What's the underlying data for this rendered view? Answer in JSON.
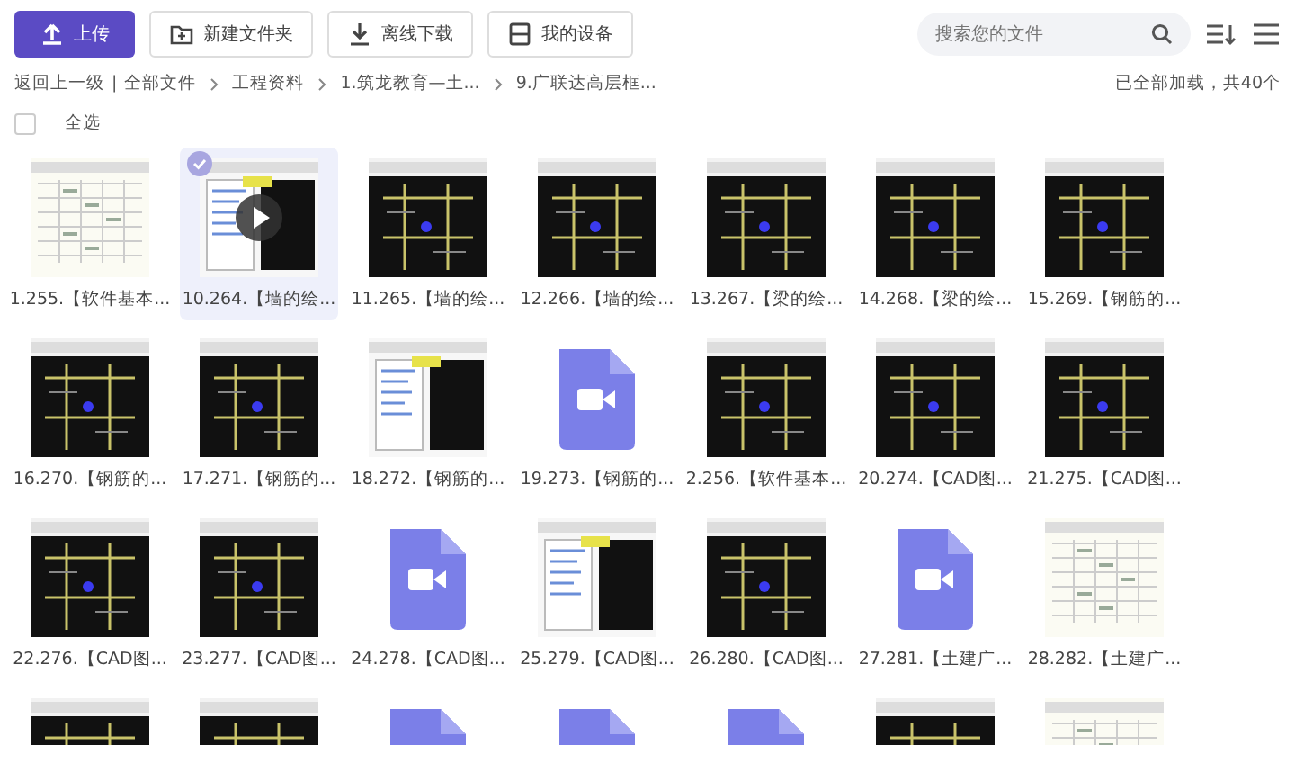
{
  "toolbar": {
    "buttons": [
      {
        "label": "上传",
        "kind": "primary"
      },
      {
        "label": "新建文件夹",
        "kind": "outline"
      },
      {
        "label": "离线下载",
        "kind": "outline"
      },
      {
        "label": "我的设备",
        "kind": "outline"
      }
    ],
    "search": {
      "placeholder": "搜索您的文件"
    }
  },
  "breadcrumb": {
    "back": "返回上一级",
    "separator": "|",
    "items": [
      "全部文件",
      "工程资料",
      "1.筑龙教育—土...",
      "9.广联达高层框..."
    ]
  },
  "status": "已全部加载，共40个",
  "select_all": {
    "label": "全选",
    "checked": false
  },
  "files": [
    {
      "name": "1.255.【软件基本...",
      "kind": "sheet",
      "selected": false,
      "hovered": false
    },
    {
      "name": "10.264.【墙的绘...",
      "kind": "dialog",
      "selected": true,
      "hovered": true
    },
    {
      "name": "11.265.【墙的绘...",
      "kind": "cad",
      "selected": false,
      "hovered": false
    },
    {
      "name": "12.266.【墙的绘...",
      "kind": "cad",
      "selected": false,
      "hovered": false
    },
    {
      "name": "13.267.【梁的绘...",
      "kind": "cad",
      "selected": false,
      "hovered": false
    },
    {
      "name": "14.268.【梁的绘...",
      "kind": "cad",
      "selected": false,
      "hovered": false
    },
    {
      "name": "15.269.【钢筋的...",
      "kind": "cad",
      "selected": false,
      "hovered": false
    },
    {
      "name": "16.270.【钢筋的...",
      "kind": "cad",
      "selected": false,
      "hovered": false
    },
    {
      "name": "17.271.【钢筋的...",
      "kind": "cad",
      "selected": false,
      "hovered": false
    },
    {
      "name": "18.272.【钢筋的...",
      "kind": "dialog",
      "selected": false,
      "hovered": false
    },
    {
      "name": "19.273.【钢筋的...",
      "kind": "video",
      "selected": false,
      "hovered": false
    },
    {
      "name": "2.256.【软件基本...",
      "kind": "cad",
      "selected": false,
      "hovered": false
    },
    {
      "name": "20.274.【CAD图...",
      "kind": "cad",
      "selected": false,
      "hovered": false
    },
    {
      "name": "21.275.【CAD图...",
      "kind": "cad",
      "selected": false,
      "hovered": false
    },
    {
      "name": "22.276.【CAD图...",
      "kind": "cad",
      "selected": false,
      "hovered": false
    },
    {
      "name": "23.277.【CAD图...",
      "kind": "cad",
      "selected": false,
      "hovered": false
    },
    {
      "name": "24.278.【CAD图...",
      "kind": "video",
      "selected": false,
      "hovered": false
    },
    {
      "name": "25.279.【CAD图...",
      "kind": "dialog",
      "selected": false,
      "hovered": false
    },
    {
      "name": "26.280.【CAD图...",
      "kind": "cad",
      "selected": false,
      "hovered": false
    },
    {
      "name": "27.281.【土建广...",
      "kind": "video",
      "selected": false,
      "hovered": false
    },
    {
      "name": "28.282.【土建广...",
      "kind": "sheet",
      "selected": false,
      "hovered": false
    },
    {
      "kind": "cad",
      "selected": false,
      "hovered": false
    },
    {
      "kind": "cad",
      "selected": false,
      "hovered": false
    },
    {
      "kind": "video",
      "selected": false,
      "hovered": false
    },
    {
      "kind": "video",
      "selected": false,
      "hovered": false
    },
    {
      "kind": "video",
      "selected": false,
      "hovered": false
    },
    {
      "kind": "cad",
      "selected": false,
      "hovered": false
    },
    {
      "kind": "sheet",
      "selected": false,
      "hovered": false
    }
  ]
}
